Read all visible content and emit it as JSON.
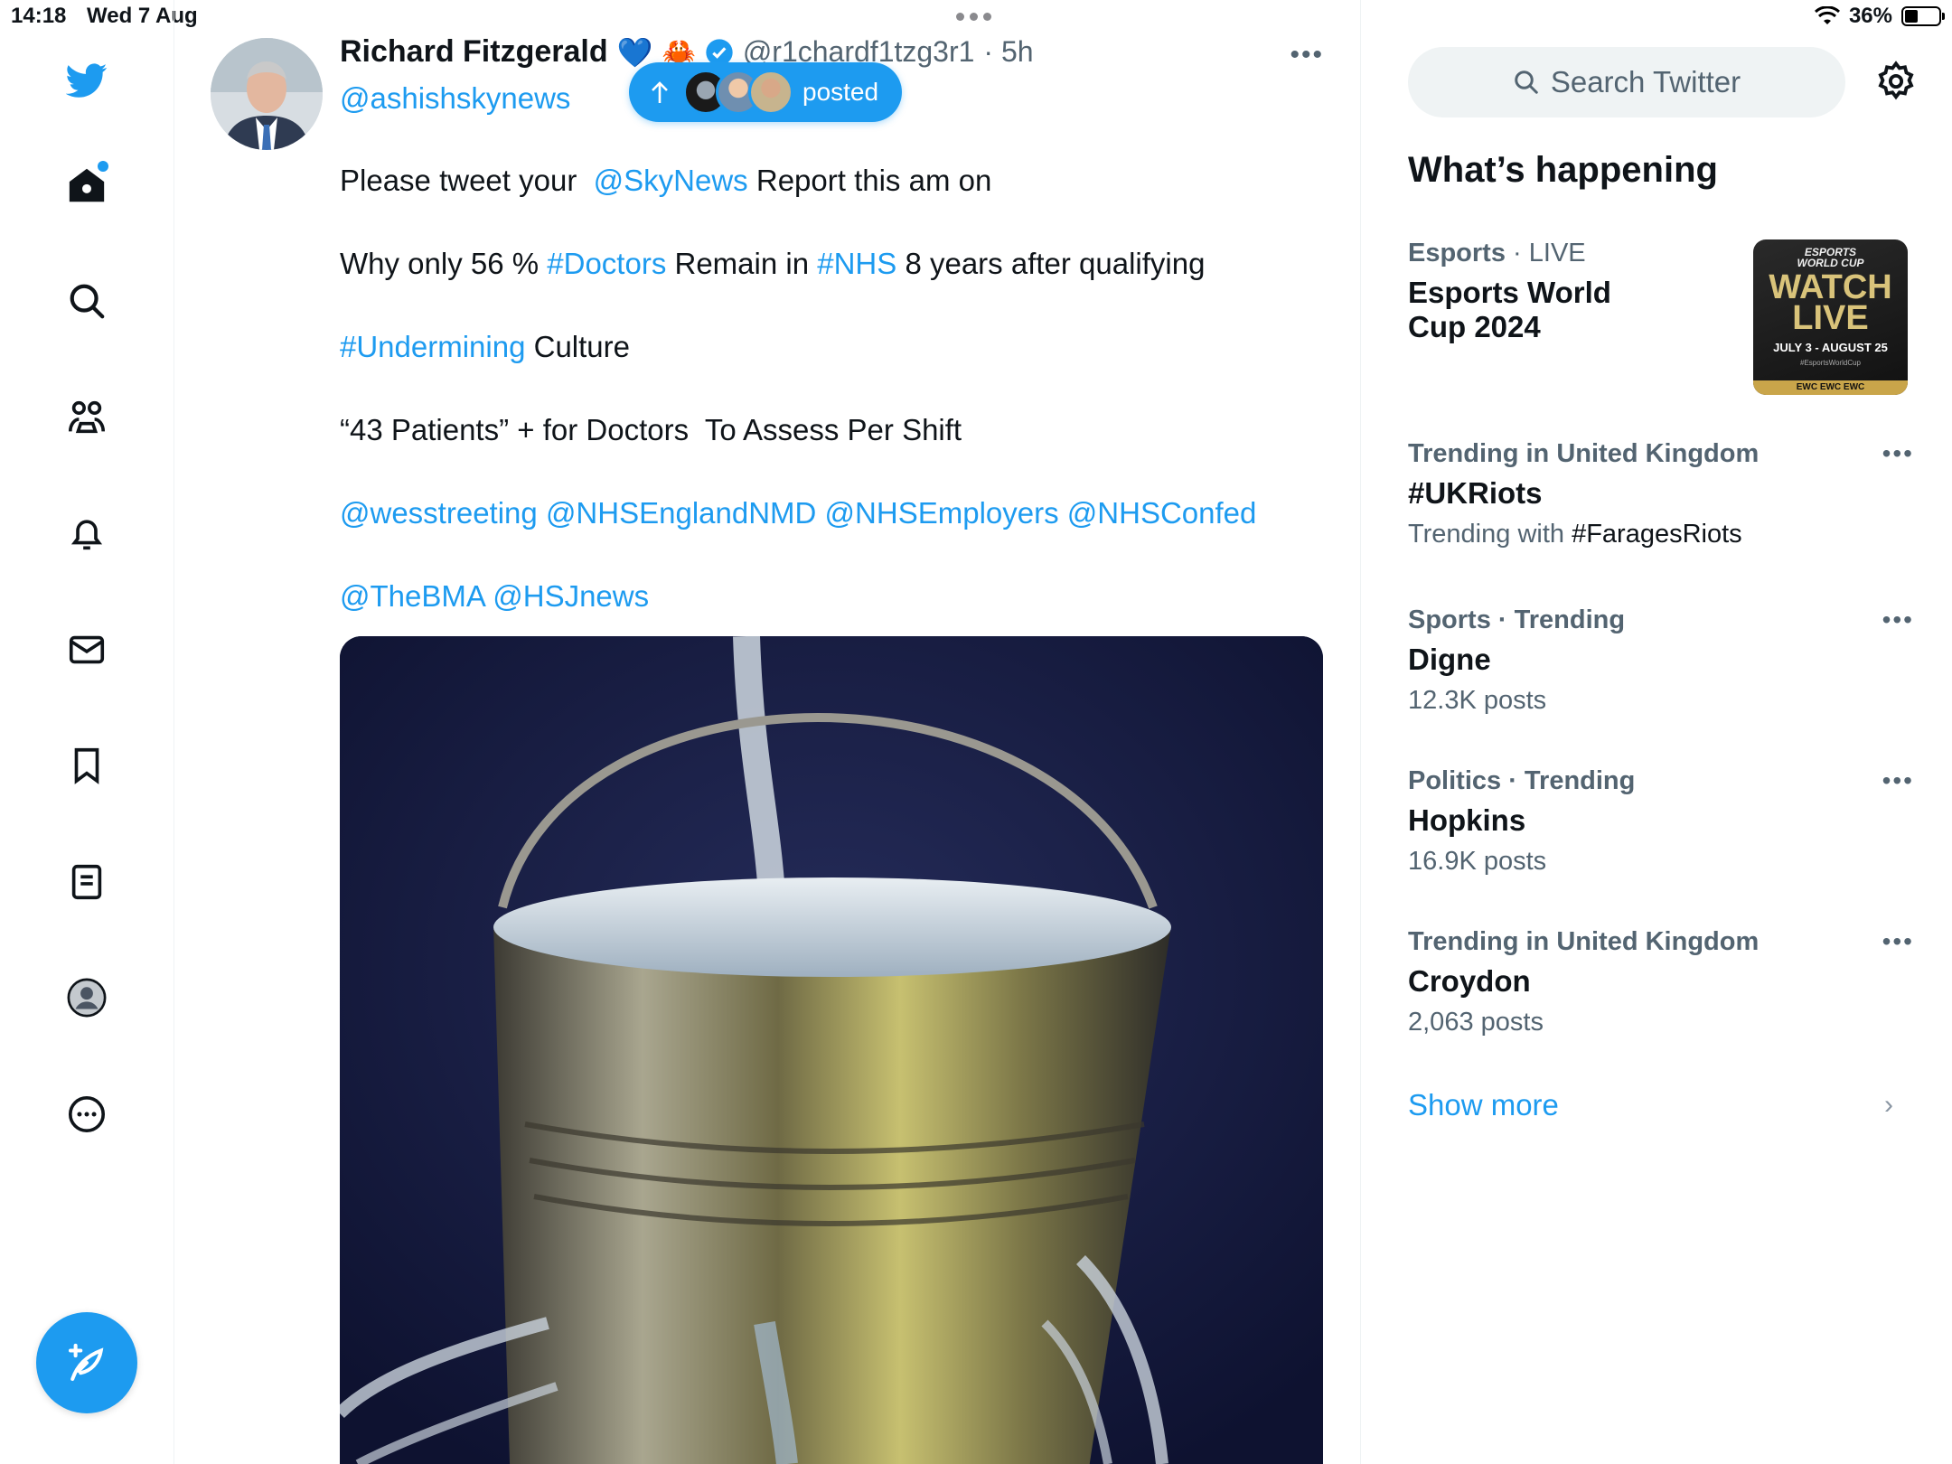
{
  "status_bar": {
    "time": "14:18",
    "date": "Wed 7 Aug",
    "battery": "36%",
    "battery_level": 0.36
  },
  "nav": {
    "items": [
      {
        "icon": "twitter-bird-icon"
      },
      {
        "icon": "home-icon",
        "has_notification_dot": true
      },
      {
        "icon": "search-icon"
      },
      {
        "icon": "communities-icon"
      },
      {
        "icon": "notifications-bell-icon"
      },
      {
        "icon": "messages-envelope-icon"
      },
      {
        "icon": "bookmark-icon"
      },
      {
        "icon": "lists-icon"
      },
      {
        "icon": "profile-avatar-icon"
      },
      {
        "icon": "more-circle-icon"
      }
    ],
    "compose_icon": "compose-feather-icon"
  },
  "tweet": {
    "author_name": "Richard Fitzgerald",
    "author_emoji": "💙",
    "author_emoji2": "🦀",
    "header_handle": "@r1chardf1tzg3r1",
    "time": "· 5h",
    "quoted_handle": "@ashishskynews",
    "posted_pill": "posted",
    "lines": {
      "l1_a": "Please tweet your",
      "l1_link": "@SkyNews",
      "l1_b": "Report this am on",
      "l2_a": "Why only 56 %",
      "l2_tag1": "#Doctors",
      "l2_b": "Remain in",
      "l2_tag2": "#NHS",
      "l2_c": "8 years after qualifying",
      "l3_tag": "#Undermining",
      "l3_b": "Culture",
      "l4": "“43 Patients” + for Doctors  To Assess Per Shift",
      "l5_m1": "@wesstreeting",
      "l5_m2": "@NHSEnglandNMD",
      "l5_m3": "@NHSEmployers",
      "l5_m4": "@NHSConfed",
      "l6_m1": "@TheBMA",
      "l6_m2": "@HSJnews"
    },
    "media_alt_icon": "leaking-bucket-image"
  },
  "sidebar": {
    "search_placeholder": "Search Twitter",
    "section_title": "What’s happening",
    "featured": {
      "meta_category": "Esports",
      "meta_status": "· LIVE",
      "title_line1": "Esports World",
      "title_line2": "Cup 2024",
      "thumb": {
        "line1": "ESPORTS",
        "line2": "WORLD CUP",
        "big1": "WATCH",
        "big2": "LIVE",
        "dates": "JULY 3 - AUGUST 25",
        "hashtag": "#EsportsWorldCup",
        "ticker": "EWC EWC EWC"
      }
    },
    "trends": [
      {
        "meta": "Trending in United Kingdom",
        "title": "#UKRiots",
        "sub_prefix": "Trending with ",
        "sub_tag": "#FaragesRiots"
      },
      {
        "meta": "Sports · Trending",
        "title": "Digne",
        "sub": "12.3K posts"
      },
      {
        "meta": "Politics · Trending",
        "title": "Hopkins",
        "sub": "16.9K posts"
      },
      {
        "meta": "Trending in United Kingdom",
        "title": "Croydon",
        "sub": "2,063 posts"
      }
    ],
    "show_more": "Show more"
  },
  "colors": {
    "accent": "#1d9bf0",
    "text": "#0f1419",
    "muted": "#536471"
  }
}
